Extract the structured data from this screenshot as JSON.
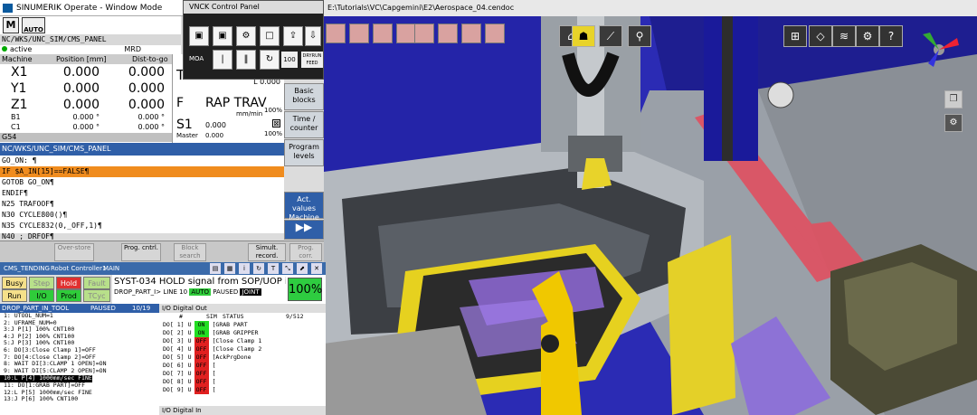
{
  "sinumerik": {
    "window_title": "SINUMERIK Operate - Window Mode",
    "mode_button": "AUTO",
    "path": "NC/WKS/UNC_SIM/CMS_PANEL",
    "active_label": "active",
    "mrd": "MRD",
    "axis_header": {
      "machine": "Machine",
      "position": "Position [mm]",
      "dist": "Dist-to-go"
    },
    "axes": [
      {
        "name": "X1",
        "pos": "0.000",
        "dist": "0.000"
      },
      {
        "name": "Y1",
        "pos": "0.000",
        "dist": "0.000"
      },
      {
        "name": "Z1",
        "pos": "0.000",
        "dist": "0.000"
      }
    ],
    "small_axes": [
      {
        "name": "B1",
        "pos": "0.000 °",
        "dist": "0.000 °"
      },
      {
        "name": "C1",
        "pos": "0.000 °",
        "dist": "0.000 °"
      }
    ],
    "g54": "G54",
    "tool_label": "T",
    "l_value": "L 0.000",
    "feed_label": "F",
    "feed_mode": "RAP TRAV",
    "feed_unit": "mm/min",
    "feed_pct": "100%",
    "spindle_label": "S1",
    "spindle_value": "0.000",
    "master_label": "Master",
    "master_value": "0.000",
    "master_pct": "100%",
    "scale": [
      "0",
      "50",
      "100",
      "150"
    ],
    "program_path": "NC/WKS/UNC_SIM/CMS_PANEL",
    "program_lines": [
      "GO_ON: ¶",
      "IF $A_IN[15]==FALSE¶",
      "  GOTOB GO_ON¶",
      "ENDIF¶",
      "N25 TRAFOOF¶",
      "N30 CYCLE800()¶",
      "N35 CYCLE832(0,_OFF,1)¶",
      "N40 ; DRFOF¶"
    ],
    "softkeys": [
      "Basic blocks",
      "Time / counter",
      "Program levels",
      "Act. values Machine"
    ],
    "bottom_keys": [
      "Over-store",
      "Prog. cntrl.",
      "Block search",
      "Simult. record.",
      "Prog. corr."
    ]
  },
  "vnck": {
    "title": "VNCK Control Panel",
    "moa": "MOA",
    "override": "100",
    "dryrun": "DRYRUN FEED"
  },
  "teach": {
    "tabs": [
      "CMS_TENDING",
      "Robot Controller1",
      "MAIN"
    ],
    "status_buttons": [
      "Busy",
      "Step",
      "Hold",
      "Fault",
      "Run",
      "I/O",
      "Prod",
      "TCyc"
    ],
    "message": "SYST-034 HOLD signal from SOP/UOP is lost",
    "sub_message": "DROP_PART_I> LINE 10",
    "auto_label": "AUTO",
    "paused_label": "PAUSED",
    "joint_label": "JOINT",
    "percent": "100%",
    "program_header": "DROP_PART_IN_TOOL",
    "program_status": "PAUSED",
    "program_line_count": "10/19",
    "program_lines": [
      "1:  UTOOL_NUM=1",
      "2:  UFRAME_NUM=0",
      "3:J  P[1] 100% CNT100",
      "4:J  P[2] 100% CNT100",
      "5:J  P[3] 100% CNT100",
      "6:  DO[3:Close Clamp 1]=OFF",
      "7:  DO[4:Close Clamp 2]=OFF",
      "8:  WAIT DI[3:CLAMP 1 OPEN]=ON",
      "9:  WAIT DI[5:CLAMP 2 OPEN]=ON",
      "10:L  P[4] 1000mm/sec FINE",
      "11:  DO[1:GRAB PART]=OFF",
      "12:L  P[5] 1000mm/sec FINE",
      "13:J  P[6] 100% CNT100"
    ],
    "io_header": "I/O Digital Out",
    "io_cols": {
      "num": "#",
      "sim": "SIM",
      "status": "STATUS",
      "range": "9/512"
    },
    "io_rows": [
      {
        "label": "DO[",
        "num": "1]",
        "u": "U",
        "status": "ON",
        "name": "[GRAB PART"
      },
      {
        "label": "DO[",
        "num": "2]",
        "u": "U",
        "status": "ON",
        "name": "[GRAB GRIPPER"
      },
      {
        "label": "DO[",
        "num": "3]",
        "u": "U",
        "status": "OFF",
        "name": "[Close Clamp 1"
      },
      {
        "label": "DO[",
        "num": "4]",
        "u": "U",
        "status": "OFF",
        "name": "[Close Clamp 2"
      },
      {
        "label": "DO[",
        "num": "5]",
        "u": "U",
        "status": "OFF",
        "name": "[AckPrgDone"
      },
      {
        "label": "DO[",
        "num": "6]",
        "u": "U",
        "status": "OFF",
        "name": "["
      },
      {
        "label": "DO[",
        "num": "7]",
        "u": "U",
        "status": "OFF",
        "name": "["
      },
      {
        "label": "DO[",
        "num": "8]",
        "u": "U",
        "status": "OFF",
        "name": "["
      },
      {
        "label": "DO[",
        "num": "9]",
        "u": "U",
        "status": "OFF",
        "name": "["
      }
    ],
    "io_in_header": "I/O Digital In"
  },
  "viewer": {
    "title": "E:\\Tutorials\\VC\\Capgemini\\E2\\Aerospace_04.cendoc"
  },
  "colors": {
    "on": "#22dd22",
    "off": "#e02020",
    "highlight": "#f08c1e",
    "header_blue": "#2f5fa8"
  }
}
